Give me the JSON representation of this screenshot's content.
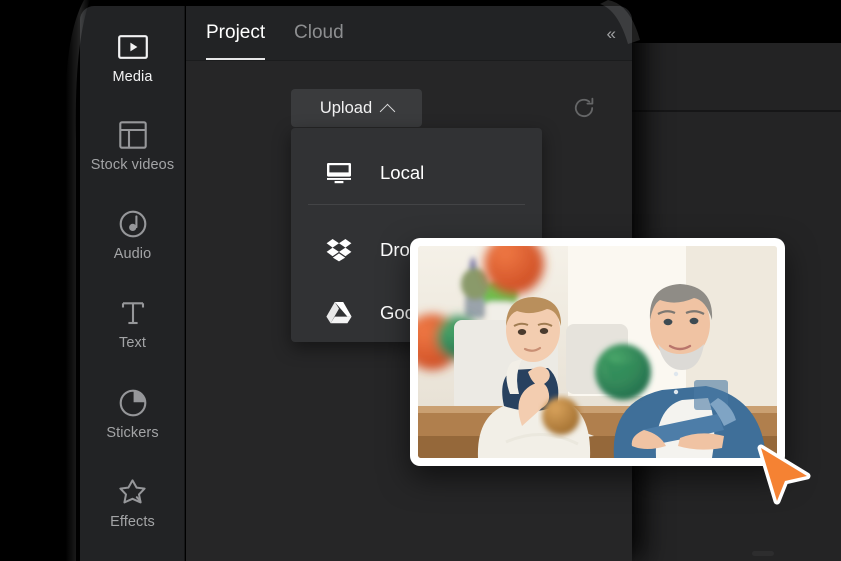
{
  "app": {
    "accent_orange": "#f58233",
    "panel_bg": "#262627",
    "rail_bg": "#222325",
    "menu_bg": "#313234",
    "button_bg": "#3a3b3d"
  },
  "sidebar": {
    "items": [
      {
        "label": "Media",
        "icon": "media-play-rectangle-icon",
        "active": true
      },
      {
        "label": "Stock videos",
        "icon": "stock-videos-layout-icon",
        "active": false
      },
      {
        "label": "Audio",
        "icon": "audio-note-icon",
        "active": false
      },
      {
        "label": "Text",
        "icon": "text-t-icon",
        "active": false
      },
      {
        "label": "Stickers",
        "icon": "stickers-circle-icon",
        "active": false
      },
      {
        "label": "Effects",
        "icon": "effects-star-icon",
        "active": false
      }
    ]
  },
  "tabs": {
    "items": [
      {
        "label": "Project",
        "active": true
      },
      {
        "label": "Cloud",
        "active": false
      }
    ],
    "collapse_icon": "double-chevron-left-icon",
    "collapse_glyph": "«"
  },
  "toolbar": {
    "upload_label": "Upload",
    "upload_caret_icon": "chevron-up-icon",
    "refresh_icon": "refresh-icon"
  },
  "upload_menu": {
    "items": [
      {
        "label": "Local",
        "icon": "monitor-icon"
      },
      {
        "label": "Dropbox",
        "icon": "dropbox-icon"
      },
      {
        "label": "Google Drive",
        "icon": "google-drive-icon"
      }
    ]
  },
  "media_thumbnail": {
    "name": "media-thumbnail-photo",
    "description": "Photo of a man and a boy at a table with globes and potted plants"
  },
  "cursor": {
    "name": "orange-arrow-cursor"
  }
}
